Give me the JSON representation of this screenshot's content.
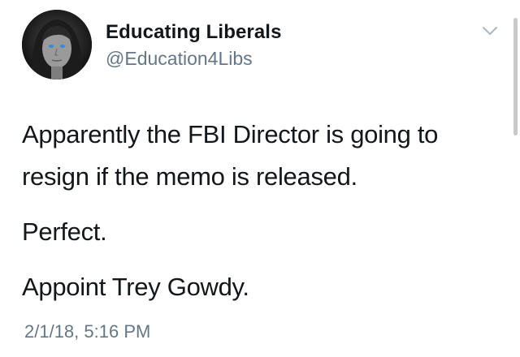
{
  "author": {
    "display_name": "Educating Liberals",
    "handle": "@Education4Libs",
    "avatar_icon": "profile-avatar"
  },
  "menu": {
    "icon": "chevron-down-icon"
  },
  "tweet": {
    "paragraphs": [
      "Apparently the FBI Director is going to resign if the memo is released.",
      "Perfect.",
      "Appoint Trey Gowdy."
    ],
    "timestamp": "2/1/18, 5:16 PM"
  },
  "colors": {
    "text": "#14171a",
    "secondary": "#657786"
  }
}
